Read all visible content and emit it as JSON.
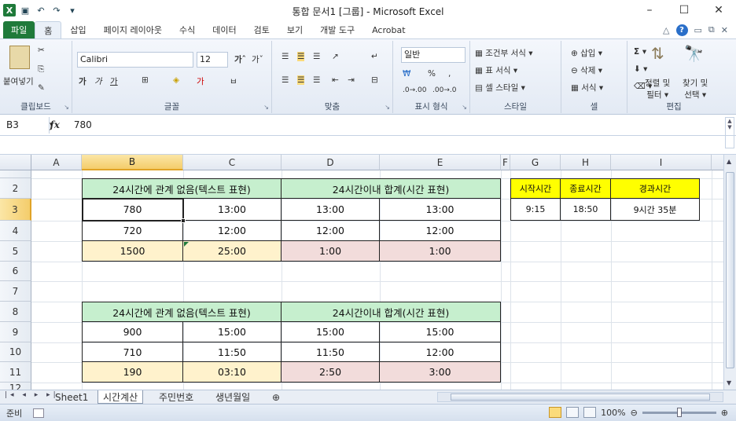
{
  "window": {
    "title": "통합 문서1  [그룹]  -  Microsoft Excel"
  },
  "ribbon_tabs": [
    "파일",
    "홈",
    "삽입",
    "페이지 레이아웃",
    "수식",
    "데이터",
    "검토",
    "보기",
    "개발 도구",
    "Acrobat"
  ],
  "ribbon": {
    "clipboard": {
      "paste": "붙여넣기",
      "label": "클립보드"
    },
    "font": {
      "name": "Calibri",
      "size": "12",
      "label": "글꼴"
    },
    "align": {
      "label": "맞춤"
    },
    "number": {
      "format": "일반",
      "pct": "%",
      "comma": ",",
      "label": "표시 형식"
    },
    "styles": {
      "cond": "조건부 서식",
      "table": "표 서식",
      "cell": "셀 스타일",
      "label": "스타일"
    },
    "cells": {
      "insert": "삽입",
      "delete": "삭제",
      "format": "서식",
      "label": "셀"
    },
    "edit": {
      "sort": "정렬 및",
      "sort2": "필터",
      "find": "찾기 및",
      "find2": "선택",
      "label": "편집"
    }
  },
  "formula_bar": {
    "name_box": "B3",
    "fx": "fx",
    "value": "780"
  },
  "columns": [
    "A",
    "B",
    "C",
    "D",
    "E",
    "F",
    "G",
    "H",
    "I"
  ],
  "rows": [
    "2",
    "3",
    "4",
    "5",
    "6",
    "7",
    "8",
    "9",
    "10",
    "11",
    "12"
  ],
  "table1": {
    "header_text": "24시간에 관계 없음(텍스트 표현)",
    "header_time": "24시간이내 합계(시간 표현)",
    "r3": [
      "780",
      "13:00",
      "13:00",
      "13:00"
    ],
    "r4": [
      "720",
      "12:00",
      "12:00",
      "12:00"
    ],
    "r5": [
      "1500",
      "25:00",
      "1:00",
      "1:00"
    ]
  },
  "table2": {
    "header_text": "24시간에 관계 없음(텍스트 표현)",
    "header_time": "24시간이내 합계(시간 표현)",
    "r9": [
      "900",
      "15:00",
      "15:00",
      "15:00"
    ],
    "r10": [
      "710",
      "11:50",
      "11:50",
      "12:00"
    ],
    "r11": [
      "190",
      "03:10",
      "2:50",
      "3:00"
    ]
  },
  "table3": {
    "headers": [
      "시작시간",
      "종료시간",
      "경과시간"
    ],
    "values": [
      "9:15",
      "18:50",
      "9시간 35분"
    ]
  },
  "sheets": [
    "Sheet1",
    "시간계산",
    "주민번호",
    "생년월일"
  ],
  "status": {
    "ready": "준비",
    "zoom": "100%"
  },
  "colors": {
    "header_green": "#c6efce",
    "total_yellow": "#fff2cc",
    "total_pink": "#f2dcdb",
    "header_yellow": "#ffff00"
  }
}
